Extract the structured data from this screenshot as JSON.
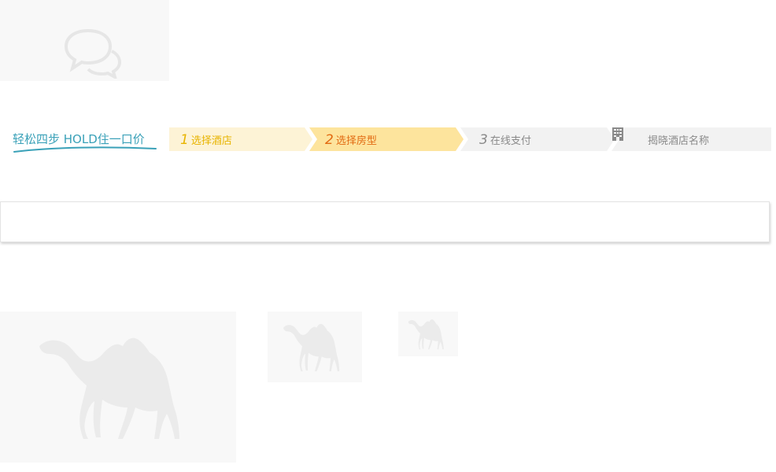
{
  "slogan": {
    "text": "轻松四步 HOLD住一口价"
  },
  "steps": [
    {
      "number": "1",
      "label": "选择酒店",
      "state": "done",
      "fill": "#fdf3d6",
      "color": "#e8b400"
    },
    {
      "number": "2",
      "label": "选择房型",
      "state": "active",
      "fill": "#fde49d",
      "color": "#e26b12"
    },
    {
      "number": "3",
      "label": "在线支付",
      "state": "pending",
      "fill": "#f2f2f2",
      "color": "#8a8a8a"
    },
    {
      "number": "",
      "label": "揭晓酒店名称",
      "state": "pending",
      "fill": "#f2f2f2",
      "color": "#8a8a8a",
      "icon": "hotel-building-icon"
    }
  ],
  "placeholders": {
    "chat": "chat-bubbles-icon",
    "images": [
      "camel-icon",
      "camel-icon",
      "camel-icon"
    ]
  }
}
